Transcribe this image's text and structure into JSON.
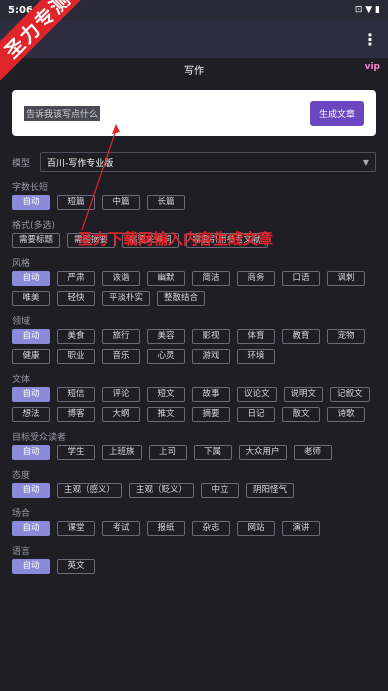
{
  "status": {
    "time": "5:06",
    "icons": "⊡ ▼ ▮"
  },
  "appbar": {
    "menu": "⋮"
  },
  "toolbar": {
    "title": "写作",
    "vip_badge": "vip"
  },
  "watermark": {
    "ribbon": "圣力专测",
    "annotation": "圣力下载网输入内容生成文章"
  },
  "input": {
    "placeholder": "告诉我该写点什么",
    "generate": "生成文章"
  },
  "model": {
    "label": "模型",
    "value": "百川-写作专业版"
  },
  "sections": [
    {
      "title": "字数长短",
      "chips": [
        "自动",
        "短篇",
        "中篇",
        "长篇"
      ],
      "active": 0
    },
    {
      "title": "格式(多选)",
      "chips": [
        "需要标题",
        "需要摘要",
        "需要关键词",
        "需要引用参考文献"
      ],
      "active": -1
    },
    {
      "title": "风格",
      "chips": [
        "自动",
        "严肃",
        "诙谐",
        "幽默",
        "简洁",
        "商务",
        "口语",
        "讽刺",
        "唯美",
        "轻快",
        "平淡朴实",
        "整散结合"
      ],
      "active": 0
    },
    {
      "title": "领域",
      "chips": [
        "自动",
        "美食",
        "旅行",
        "美容",
        "影视",
        "体育",
        "教育",
        "宠物",
        "健康",
        "职业",
        "音乐",
        "心灵",
        "游戏",
        "环境"
      ],
      "active": 0
    },
    {
      "title": "文体",
      "chips": [
        "自动",
        "短信",
        "评论",
        "短文",
        "故事",
        "议论文",
        "说明文",
        "记叙文",
        "想法",
        "博客",
        "大纲",
        "推文",
        "摘要",
        "日记",
        "散文",
        "诗歌"
      ],
      "active": 0
    },
    {
      "title": "目标受众读者",
      "chips": [
        "自动",
        "学生",
        "上班族",
        "上司",
        "下属",
        "大众用户",
        "老师"
      ],
      "active": 0
    },
    {
      "title": "态度",
      "chips": [
        "自动",
        "主观（感义）",
        "主观（贬义）",
        "中立",
        "阴阳怪气"
      ],
      "active": 0
    },
    {
      "title": "场合",
      "chips": [
        "自动",
        "课堂",
        "考试",
        "报纸",
        "杂志",
        "网站",
        "演讲"
      ],
      "active": 0
    },
    {
      "title": "语言",
      "chips": [
        "自动",
        "英文"
      ],
      "active": 0
    }
  ]
}
